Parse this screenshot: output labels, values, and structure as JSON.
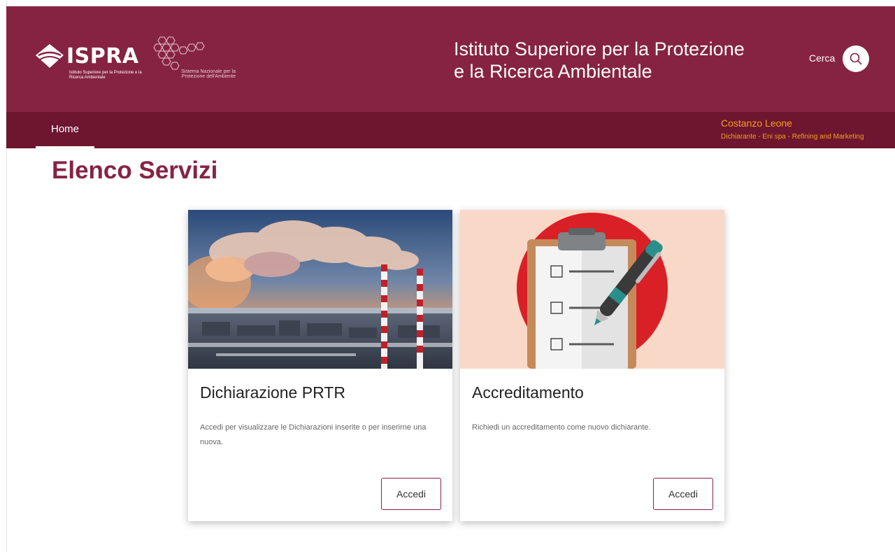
{
  "header": {
    "logo_brand": "ISPRA",
    "logo_subtitle": "Istituto Superiore per la Protezione e la Ricerca Ambientale",
    "snpa_text": "Sistema Nazionale per la Protezione dell'Ambiente",
    "site_title_line1": "Istituto Superiore per la Protezione",
    "site_title_line2": "e la Ricerca Ambientale",
    "search_label": "Cerca",
    "color_primary": "#862343",
    "color_nav": "#6e1530"
  },
  "nav": {
    "home_label": "Home",
    "user_name": "Costanzo Leone",
    "user_role": "Dichiarante - Eni spa - Refining and Marketing",
    "user_color": "#f6a01a"
  },
  "main": {
    "title": "Elenco Servizi",
    "cards": [
      {
        "image": "industrial-smokestacks-image",
        "title": "Dichiarazione PRTR",
        "text": "Accedi per visualizzare le Dichiarazioni inserite o per inserirne una nuova.",
        "button": "Accedi"
      },
      {
        "image": "clipboard-checklist-image",
        "title": "Accreditamento",
        "text": "Richiedi un accreditamento come nuovo dichiarante.",
        "button": "Accedi"
      }
    ]
  }
}
